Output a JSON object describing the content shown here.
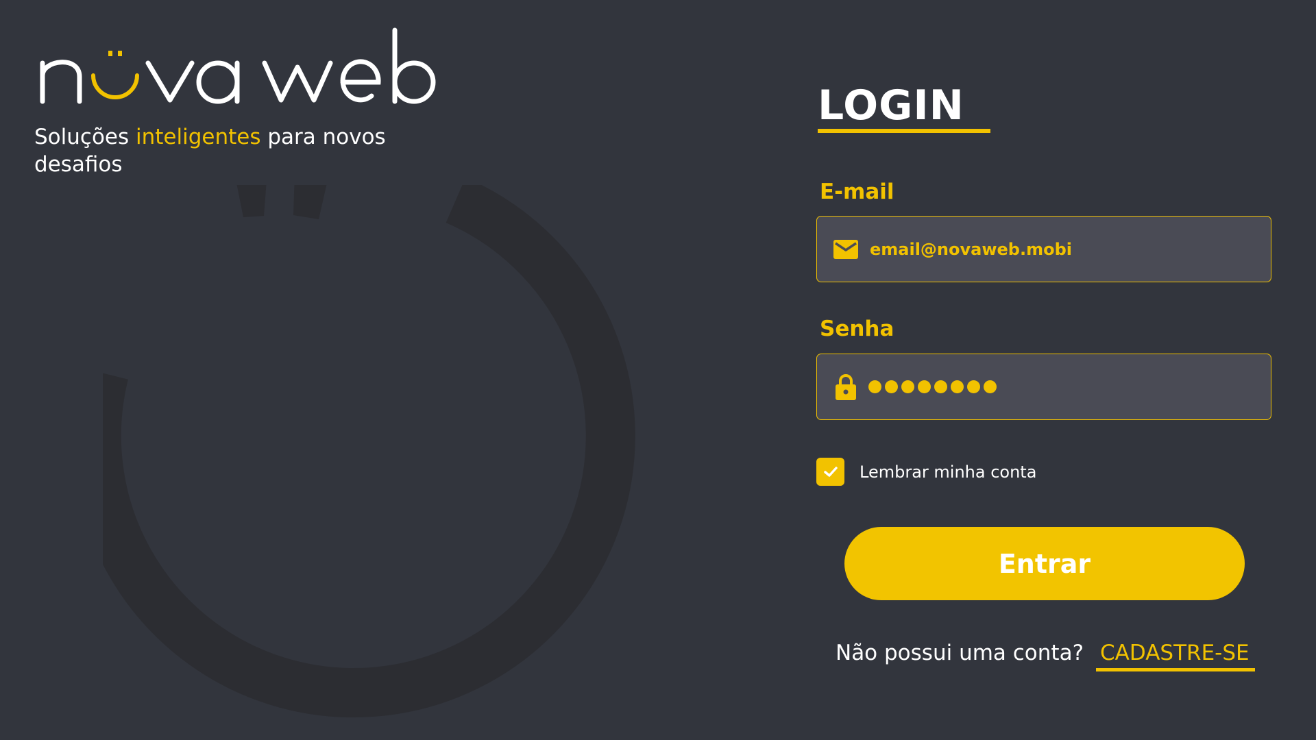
{
  "brand": {
    "logo_text": "nova web",
    "tagline_start": "Soluções ",
    "tagline_accent": "inteligentes",
    "tagline_end": " para novos desafios"
  },
  "login": {
    "title": "LOGIN",
    "email_label": "E-mail",
    "email_value": "email@novaweb.mobi",
    "password_label": "Senha",
    "password_length": 8,
    "remember_label": "Lembrar minha conta",
    "remember_checked": true,
    "submit_label": "Entrar",
    "signup_question": "Não possui uma conta?",
    "signup_link": "CADASTRE-SE"
  },
  "icons": {
    "email": "mail-icon",
    "password": "lock-icon",
    "checkbox": "checkmark-icon"
  },
  "colors": {
    "background": "#32353d",
    "accent": "#f2c200",
    "field_background": "#4a4b55",
    "text": "#ffffff"
  }
}
